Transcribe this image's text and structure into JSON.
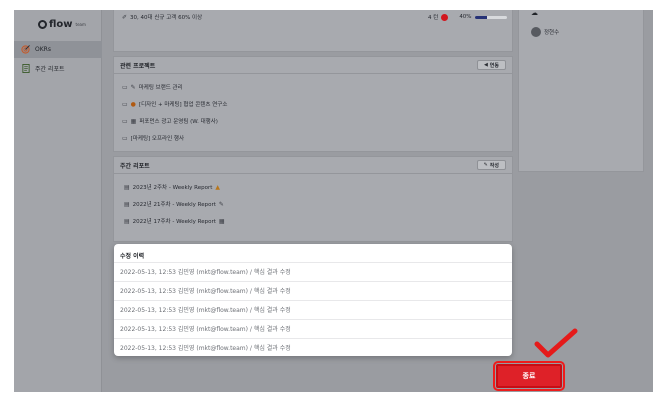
{
  "app": {
    "logo_text": "flow",
    "logo_sub": "team"
  },
  "sidebar": {
    "items": [
      {
        "label": "OKRs",
        "icon": "target-icon",
        "active": true
      },
      {
        "label": "주간 리포트",
        "icon": "report-icon",
        "active": false
      }
    ]
  },
  "okr_row": {
    "text": "30, 40대 신규 고객 60% 이상",
    "count": "4 턴",
    "percent": "40%",
    "progress": 0.4
  },
  "related_projects": {
    "title": "관련 프로젝트",
    "button_label": "연동",
    "items": [
      {
        "label": "마케팅 브랜드 관리"
      },
      {
        "label": "[디자인 + 마케팅] 협업 콘텐츠 연구소"
      },
      {
        "label": "퍼포먼스 광고 운영팀 (W. 대행사)"
      },
      {
        "label": "[마케팅] 오프라인 행사"
      }
    ]
  },
  "weekly_reports": {
    "title": "주간 리포트",
    "button_label": "작성",
    "items": [
      {
        "label": "2023년 2주차 - Weekly Report"
      },
      {
        "label": "2022년 21주차 - Weekly Report"
      },
      {
        "label": "2022년 17주차 - Weekly Report"
      }
    ]
  },
  "right_panel": {
    "member_name": "정현수"
  },
  "modal": {
    "title": "수정 이력",
    "rows": [
      "2022-05-13, 12:53  김민영 (mkt@flow.team) / 핵심 결과 수정",
      "2022-05-13, 12:53  김민영 (mkt@flow.team) / 핵심 결과 수정",
      "2022-05-13, 12:53  김민영 (mkt@flow.team) / 핵심 결과 수정",
      "2022-05-13, 12:53  김민영 (mkt@flow.team) / 핵심 결과 수정",
      "2022-05-13, 12:53  김민영 (mkt@flow.team) / 핵심 결과 수정"
    ]
  },
  "footer": {
    "close_label": "종료"
  },
  "colors": {
    "accent_red": "#de2128",
    "progress_navy": "#263276",
    "overlay_gray": "#9a9ca1"
  }
}
